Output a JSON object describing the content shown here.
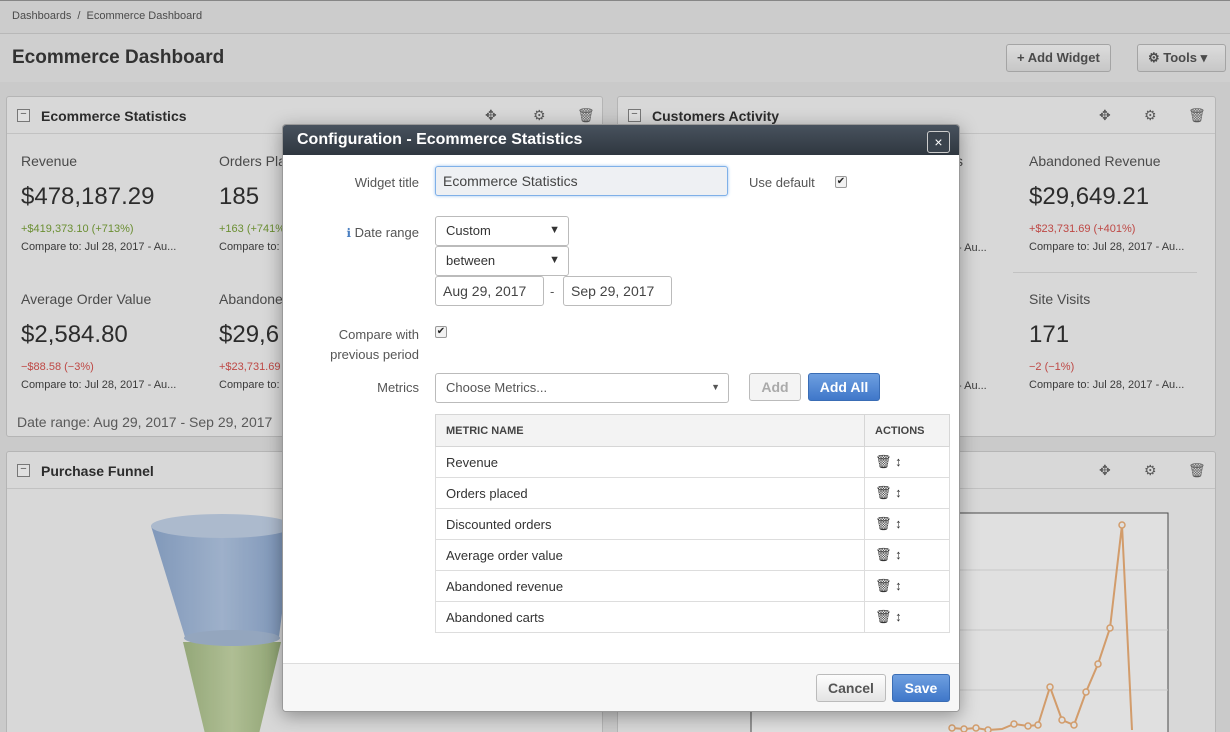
{
  "breadcrumb": {
    "home": "Dashboards",
    "sep": "/",
    "current": "Ecommerce Dashboard"
  },
  "page_title": "Ecommerce Dashboard",
  "toolbar": {
    "add_widget": "+ Add Widget",
    "tools": "⚙ Tools ▾"
  },
  "widgets": {
    "ecommerce_stats": {
      "title": "Ecommerce Statistics",
      "date_range": "Date range: Aug 29, 2017 - Sep 29, 2017",
      "stats": [
        {
          "label": "Revenue",
          "value": "$478,187.29",
          "change": "+$419,373.10 (+713%)",
          "compare": "Compare to:    Jul 28, 2017 - Au..."
        },
        {
          "label": "Orders Pla",
          "value": "185",
          "change": "+163 (+741%",
          "compare": "Compare to:"
        },
        {
          "label": "Average Order Value",
          "value": "$2,584.80",
          "change": "−$88.58 (−3%)",
          "compare": "Compare to:    Jul 28, 2017 - Au..."
        },
        {
          "label": "Abandone",
          "value": "$29,6",
          "change": "+$23,731.69",
          "compare": "Compare to:"
        }
      ]
    },
    "customers_activity": {
      "title": "Customers Activity",
      "stats": [
        {
          "label": "Abandoned Revenue",
          "value": "$29,649.21",
          "change": "+$23,731.69 (+401%)",
          "compare": "Compare to:    Jul 28, 2017 - Au..."
        },
        {
          "label": "Site Visits",
          "value": "171",
          "change": "−2 (−1%)",
          "compare": "Compare to:    Jul 28, 2017 - Au..."
        }
      ],
      "clipped": {
        "s": "s",
        "au1": "- Au...",
        "au2": "- Au..."
      }
    },
    "purchase_funnel": {
      "title": "Purchase Funnel"
    }
  },
  "modal": {
    "title": "Configuration - Ecommerce Statistics",
    "close": "×",
    "widget_title_label": "Widget title",
    "widget_title_value": "Ecommerce Statistics",
    "use_default_label": "Use default",
    "date_range_label": "Date range",
    "date_range_type": "Custom",
    "date_range_op": "between",
    "date_from": "Aug 29, 2017",
    "date_sep": "-",
    "date_to": "Sep 29, 2017",
    "compare_label_1": "Compare with",
    "compare_label_2": "previous period",
    "metrics_label": "Metrics",
    "metrics_placeholder": "Choose Metrics...",
    "add": "Add",
    "add_all": "Add All",
    "table_headers": {
      "name": "METRIC NAME",
      "actions": "ACTIONS"
    },
    "metrics": [
      "Revenue",
      "Orders placed",
      "Discounted orders",
      "Average order value",
      "Abandoned revenue",
      "Abandoned carts"
    ],
    "cancel": "Cancel",
    "save": "Save"
  }
}
